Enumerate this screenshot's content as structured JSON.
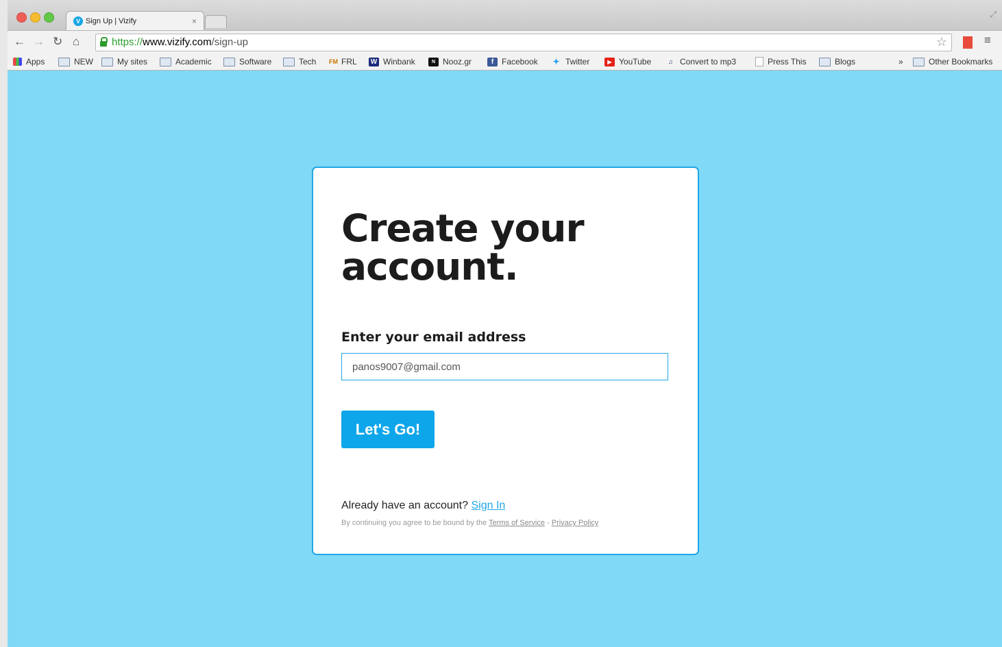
{
  "browser": {
    "tab_title": "Sign Up | Vizify",
    "tab_close": "×",
    "url_protocol": "https://",
    "url_host": "www.vizify.com",
    "url_path": "/sign-up"
  },
  "bookmarks": {
    "items": [
      {
        "label": "Apps",
        "icon": "apps-grid-icon"
      },
      {
        "label": "NEW",
        "icon": "folder-icon"
      },
      {
        "label": "My sites",
        "icon": "folder-icon"
      },
      {
        "label": "Academic",
        "icon": "folder-icon"
      },
      {
        "label": "Software",
        "icon": "folder-icon"
      },
      {
        "label": "Tech",
        "icon": "folder-icon"
      },
      {
        "label": "FRL",
        "icon": "frl-icon"
      },
      {
        "label": "Winbank",
        "icon": "winbank-icon"
      },
      {
        "label": "Nooz.gr",
        "icon": "nooz-icon"
      },
      {
        "label": "Facebook",
        "icon": "facebook-icon"
      },
      {
        "label": "Twitter",
        "icon": "twitter-icon"
      },
      {
        "label": "YouTube",
        "icon": "youtube-icon"
      },
      {
        "label": "Convert to mp3",
        "icon": "mp3-icon"
      },
      {
        "label": "Press This",
        "icon": "page-icon"
      },
      {
        "label": "Blogs",
        "icon": "folder-icon"
      }
    ],
    "overflow": "»",
    "other": "Other Bookmarks"
  },
  "signup": {
    "heading": "Create your account.",
    "email_label": "Enter your email address",
    "email_value": "panos9007@gmail.com",
    "submit_label": "Let's Go!",
    "already_text": "Already have an account?",
    "sign_in_link": "Sign In",
    "terms_text": "By continuing you agree to be bound by the",
    "terms_link": "Terms of Service",
    "separator": "-",
    "privacy_link": "Privacy Policy"
  },
  "colors": {
    "page_background": "#80d9f7",
    "accent": "#1fa7e6",
    "button": "#0ea6ea"
  }
}
